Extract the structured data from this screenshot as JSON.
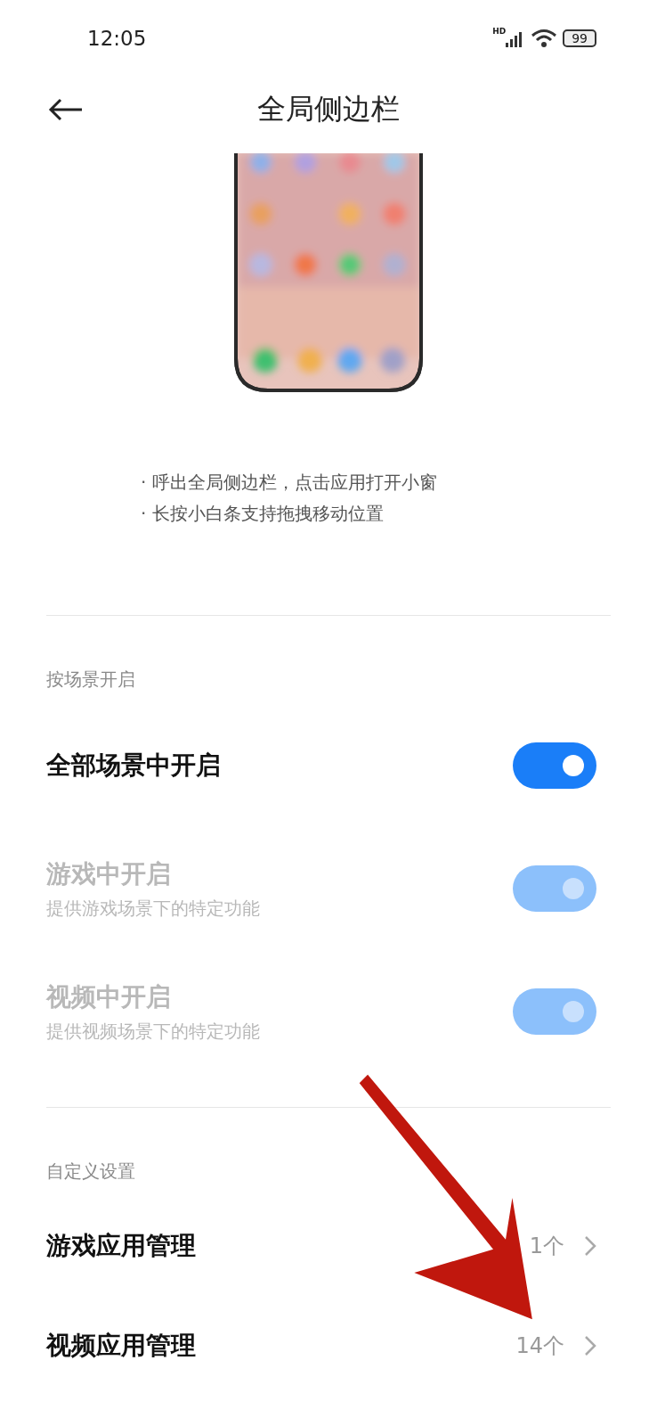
{
  "status_bar": {
    "time": "12:05",
    "network": "HD",
    "battery": "99"
  },
  "header": {
    "title": "全局侧边栏"
  },
  "preview": {
    "kind": "picture"
  },
  "description": [
    "· 呼出全局侧边栏，点击应用打开小窗",
    "· 长按小白条支持拖拽移动位置"
  ],
  "sections": [
    {
      "title": "按场景开启",
      "items": [
        {
          "kind": "toggle",
          "label": "全部场景中开启",
          "on": true,
          "disabled": false
        },
        {
          "kind": "toggle",
          "label": "游戏中开启",
          "subtitle": "提供游戏场景下的特定功能",
          "on": true,
          "disabled": true
        },
        {
          "kind": "toggle",
          "label": "视频中开启",
          "subtitle": "提供视频场景下的特定功能",
          "on": true,
          "disabled": true
        }
      ]
    },
    {
      "title": "自定义设置",
      "items": [
        {
          "kind": "link",
          "label": "游戏应用管理",
          "value": "1个"
        },
        {
          "kind": "link",
          "label": "视频应用管理",
          "value": "14个"
        }
      ]
    }
  ],
  "annotation": {
    "kind": "arrow"
  }
}
